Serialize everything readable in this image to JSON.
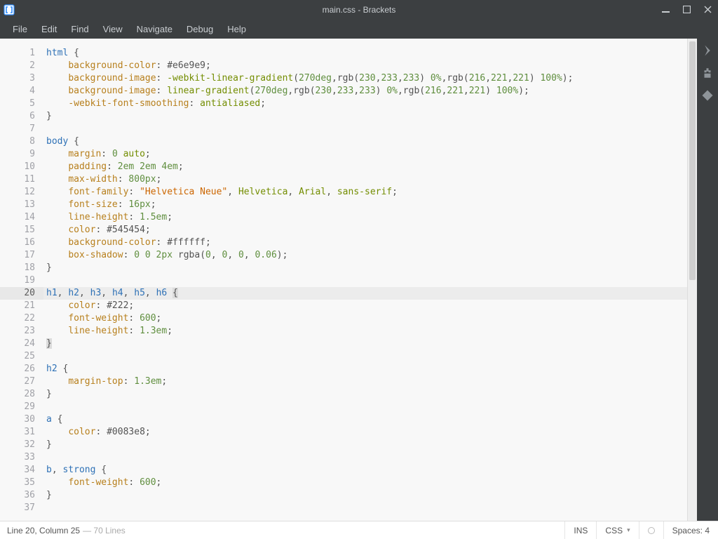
{
  "window": {
    "title": "main.css - Brackets"
  },
  "menu": [
    "File",
    "Edit",
    "Find",
    "View",
    "Navigate",
    "Debug",
    "Help"
  ],
  "status": {
    "cursor": "Line 20, Column 25",
    "lines_info": " — 70 Lines",
    "ins": "INS",
    "lang": "CSS",
    "spaces": "Spaces: 4"
  },
  "editor": {
    "active_line": 20,
    "lines": [
      {
        "n": 1,
        "tokens": [
          [
            "tag",
            "html "
          ],
          [
            "brace",
            "{"
          ]
        ]
      },
      {
        "n": 2,
        "tokens": [
          [
            "",
            "    "
          ],
          [
            "prop",
            "background-color"
          ],
          [
            "colon",
            ": "
          ],
          [
            "hex",
            "#e6e9e9"
          ],
          [
            "punc",
            ";"
          ]
        ]
      },
      {
        "n": 3,
        "tokens": [
          [
            "",
            "    "
          ],
          [
            "prop",
            "background-image"
          ],
          [
            "colon",
            ": "
          ],
          [
            "kw",
            "-webkit-linear-gradient"
          ],
          [
            "punc",
            "("
          ],
          [
            "num",
            "270deg"
          ],
          [
            "punc",
            ","
          ],
          [
            "fn",
            "rgb"
          ],
          [
            "punc",
            "("
          ],
          [
            "num",
            "230"
          ],
          [
            "punc",
            ","
          ],
          [
            "num",
            "233"
          ],
          [
            "punc",
            ","
          ],
          [
            "num",
            "233"
          ],
          [
            "punc",
            ") "
          ],
          [
            "num",
            "0%"
          ],
          [
            "punc",
            ","
          ],
          [
            "fn",
            "rgb"
          ],
          [
            "punc",
            "("
          ],
          [
            "num",
            "216"
          ],
          [
            "punc",
            ","
          ],
          [
            "num",
            "221"
          ],
          [
            "punc",
            ","
          ],
          [
            "num",
            "221"
          ],
          [
            "punc",
            ") "
          ],
          [
            "num",
            "100%"
          ],
          [
            "punc",
            ");"
          ]
        ]
      },
      {
        "n": 4,
        "tokens": [
          [
            "",
            "    "
          ],
          [
            "prop",
            "background-image"
          ],
          [
            "colon",
            ": "
          ],
          [
            "kw",
            "linear-gradient"
          ],
          [
            "punc",
            "("
          ],
          [
            "num",
            "270deg"
          ],
          [
            "punc",
            ","
          ],
          [
            "fn",
            "rgb"
          ],
          [
            "punc",
            "("
          ],
          [
            "num",
            "230"
          ],
          [
            "punc",
            ","
          ],
          [
            "num",
            "233"
          ],
          [
            "punc",
            ","
          ],
          [
            "num",
            "233"
          ],
          [
            "punc",
            ") "
          ],
          [
            "num",
            "0%"
          ],
          [
            "punc",
            ","
          ],
          [
            "fn",
            "rgb"
          ],
          [
            "punc",
            "("
          ],
          [
            "num",
            "216"
          ],
          [
            "punc",
            ","
          ],
          [
            "num",
            "221"
          ],
          [
            "punc",
            ","
          ],
          [
            "num",
            "221"
          ],
          [
            "punc",
            ") "
          ],
          [
            "num",
            "100%"
          ],
          [
            "punc",
            ");"
          ]
        ]
      },
      {
        "n": 5,
        "tokens": [
          [
            "",
            "    "
          ],
          [
            "prop",
            "-webkit-font-smoothing"
          ],
          [
            "colon",
            ": "
          ],
          [
            "kw",
            "antialiased"
          ],
          [
            "punc",
            ";"
          ]
        ]
      },
      {
        "n": 6,
        "tokens": [
          [
            "brace",
            "}"
          ]
        ]
      },
      {
        "n": 7,
        "tokens": [
          [
            "",
            ""
          ]
        ]
      },
      {
        "n": 8,
        "tokens": [
          [
            "tag",
            "body "
          ],
          [
            "brace",
            "{"
          ]
        ]
      },
      {
        "n": 9,
        "tokens": [
          [
            "",
            "    "
          ],
          [
            "prop",
            "margin"
          ],
          [
            "colon",
            ": "
          ],
          [
            "num",
            "0 "
          ],
          [
            "kw",
            "auto"
          ],
          [
            "punc",
            ";"
          ]
        ]
      },
      {
        "n": 10,
        "tokens": [
          [
            "",
            "    "
          ],
          [
            "prop",
            "padding"
          ],
          [
            "colon",
            ": "
          ],
          [
            "num",
            "2em 2em 4em"
          ],
          [
            "punc",
            ";"
          ]
        ]
      },
      {
        "n": 11,
        "tokens": [
          [
            "",
            "    "
          ],
          [
            "prop",
            "max-width"
          ],
          [
            "colon",
            ": "
          ],
          [
            "num",
            "800px"
          ],
          [
            "punc",
            ";"
          ]
        ]
      },
      {
        "n": 12,
        "tokens": [
          [
            "",
            "    "
          ],
          [
            "prop",
            "font-family"
          ],
          [
            "colon",
            ": "
          ],
          [
            "str",
            "\"Helvetica Neue\""
          ],
          [
            "punc",
            ", "
          ],
          [
            "kw",
            "Helvetica"
          ],
          [
            "punc",
            ", "
          ],
          [
            "kw",
            "Arial"
          ],
          [
            "punc",
            ", "
          ],
          [
            "kw",
            "sans-serif"
          ],
          [
            "punc",
            ";"
          ]
        ]
      },
      {
        "n": 13,
        "tokens": [
          [
            "",
            "    "
          ],
          [
            "prop",
            "font-size"
          ],
          [
            "colon",
            ": "
          ],
          [
            "num",
            "16px"
          ],
          [
            "punc",
            ";"
          ]
        ]
      },
      {
        "n": 14,
        "tokens": [
          [
            "",
            "    "
          ],
          [
            "prop",
            "line-height"
          ],
          [
            "colon",
            ": "
          ],
          [
            "num",
            "1.5em"
          ],
          [
            "punc",
            ";"
          ]
        ]
      },
      {
        "n": 15,
        "tokens": [
          [
            "",
            "    "
          ],
          [
            "prop",
            "color"
          ],
          [
            "colon",
            ": "
          ],
          [
            "hex",
            "#545454"
          ],
          [
            "punc",
            ";"
          ]
        ]
      },
      {
        "n": 16,
        "tokens": [
          [
            "",
            "    "
          ],
          [
            "prop",
            "background-color"
          ],
          [
            "colon",
            ": "
          ],
          [
            "hex",
            "#ffffff"
          ],
          [
            "punc",
            ";"
          ]
        ]
      },
      {
        "n": 17,
        "tokens": [
          [
            "",
            "    "
          ],
          [
            "prop",
            "box-shadow"
          ],
          [
            "colon",
            ": "
          ],
          [
            "num",
            "0 0 2px "
          ],
          [
            "fn",
            "rgba"
          ],
          [
            "punc",
            "("
          ],
          [
            "num",
            "0"
          ],
          [
            "punc",
            ", "
          ],
          [
            "num",
            "0"
          ],
          [
            "punc",
            ", "
          ],
          [
            "num",
            "0"
          ],
          [
            "punc",
            ", "
          ],
          [
            "num",
            "0.06"
          ],
          [
            "punc",
            ");"
          ]
        ]
      },
      {
        "n": 18,
        "tokens": [
          [
            "brace",
            "}"
          ]
        ]
      },
      {
        "n": 19,
        "tokens": [
          [
            "",
            ""
          ]
        ]
      },
      {
        "n": 20,
        "tokens": [
          [
            "tag",
            "h1"
          ],
          [
            "punc",
            ", "
          ],
          [
            "tag",
            "h2"
          ],
          [
            "punc",
            ", "
          ],
          [
            "tag",
            "h3"
          ],
          [
            "punc",
            ", "
          ],
          [
            "tag",
            "h4"
          ],
          [
            "punc",
            ", "
          ],
          [
            "tag",
            "h5"
          ],
          [
            "punc",
            ", "
          ],
          [
            "tag",
            "h6 "
          ],
          [
            "brace cursor-mark",
            "{"
          ]
        ]
      },
      {
        "n": 21,
        "tokens": [
          [
            "",
            "    "
          ],
          [
            "prop",
            "color"
          ],
          [
            "colon",
            ": "
          ],
          [
            "hex",
            "#222"
          ],
          [
            "punc",
            ";"
          ]
        ]
      },
      {
        "n": 22,
        "tokens": [
          [
            "",
            "    "
          ],
          [
            "prop",
            "font-weight"
          ],
          [
            "colon",
            ": "
          ],
          [
            "num",
            "600"
          ],
          [
            "punc",
            ";"
          ]
        ]
      },
      {
        "n": 23,
        "tokens": [
          [
            "",
            "    "
          ],
          [
            "prop",
            "line-height"
          ],
          [
            "colon",
            ": "
          ],
          [
            "num",
            "1.3em"
          ],
          [
            "punc",
            ";"
          ]
        ]
      },
      {
        "n": 24,
        "tokens": [
          [
            "brace cursor-mark",
            "}"
          ]
        ]
      },
      {
        "n": 25,
        "tokens": [
          [
            "",
            ""
          ]
        ]
      },
      {
        "n": 26,
        "tokens": [
          [
            "tag",
            "h2 "
          ],
          [
            "brace",
            "{"
          ]
        ]
      },
      {
        "n": 27,
        "tokens": [
          [
            "",
            "    "
          ],
          [
            "prop",
            "margin-top"
          ],
          [
            "colon",
            ": "
          ],
          [
            "num",
            "1.3em"
          ],
          [
            "punc",
            ";"
          ]
        ]
      },
      {
        "n": 28,
        "tokens": [
          [
            "brace",
            "}"
          ]
        ]
      },
      {
        "n": 29,
        "tokens": [
          [
            "",
            ""
          ]
        ]
      },
      {
        "n": 30,
        "tokens": [
          [
            "tag",
            "a "
          ],
          [
            "brace",
            "{"
          ]
        ]
      },
      {
        "n": 31,
        "tokens": [
          [
            "",
            "    "
          ],
          [
            "prop",
            "color"
          ],
          [
            "colon",
            ": "
          ],
          [
            "hex",
            "#0083e8"
          ],
          [
            "punc",
            ";"
          ]
        ]
      },
      {
        "n": 32,
        "tokens": [
          [
            "brace",
            "}"
          ]
        ]
      },
      {
        "n": 33,
        "tokens": [
          [
            "",
            ""
          ]
        ]
      },
      {
        "n": 34,
        "tokens": [
          [
            "tag",
            "b"
          ],
          [
            "punc",
            ", "
          ],
          [
            "tag",
            "strong "
          ],
          [
            "brace",
            "{"
          ]
        ]
      },
      {
        "n": 35,
        "tokens": [
          [
            "",
            "    "
          ],
          [
            "prop",
            "font-weight"
          ],
          [
            "colon",
            ": "
          ],
          [
            "num",
            "600"
          ],
          [
            "punc",
            ";"
          ]
        ]
      },
      {
        "n": 36,
        "tokens": [
          [
            "brace",
            "}"
          ]
        ]
      },
      {
        "n": 37,
        "tokens": [
          [
            "",
            ""
          ]
        ]
      }
    ]
  }
}
